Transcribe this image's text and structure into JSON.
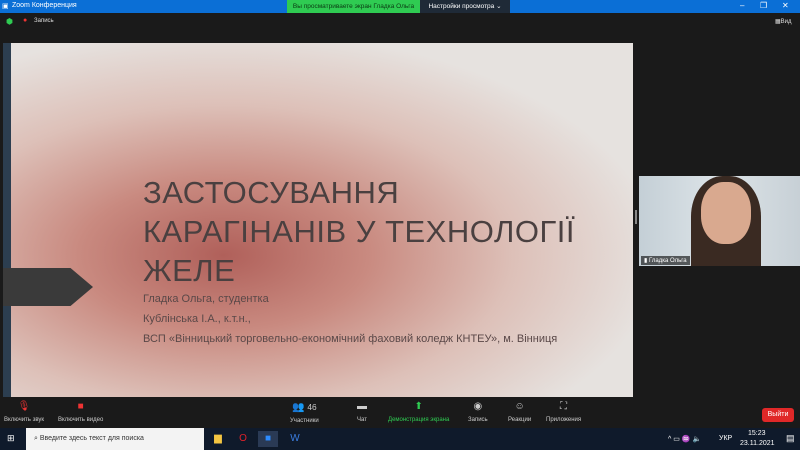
{
  "window": {
    "title": "Zoom Конференция",
    "minimize": "–",
    "maximize": "❐",
    "close": "✕"
  },
  "banner": {
    "viewing": "Вы просматриваете экран Гладка Ольга",
    "view_options": "Настройки просмотра ⌄"
  },
  "topbar": {
    "record": "Запись",
    "view": "Вид"
  },
  "slide": {
    "title_lines": [
      "ЗАСТОСУВАННЯ",
      "КАРАГІНАНІВ У ТЕХНОЛОГІЇ",
      "ЖЕЛЕ"
    ],
    "author": "Гладка Ольга, студентка",
    "supervisor": "Кублінська І.А., к.т.н.,",
    "institution": "ВСП «Вінницький торговельно-економічний фаховий коледж КНТЕУ»,  м. Вінниця"
  },
  "video": {
    "participant_name": "Гладка Ольга"
  },
  "toolbar": {
    "unmute": "Включить звук",
    "start_video": "Включить видео",
    "participants": "Участники",
    "participants_count": "46",
    "chat": "Чат",
    "share_screen": "Демонстрация экрана",
    "record": "Запись",
    "reactions": "Реакции",
    "apps": "Приложения",
    "leave": "Выйти"
  },
  "taskbar": {
    "search_placeholder": "Введите здесь текст для поиска",
    "language": "УКР",
    "time": "15:23",
    "date": "23.11.2021"
  }
}
